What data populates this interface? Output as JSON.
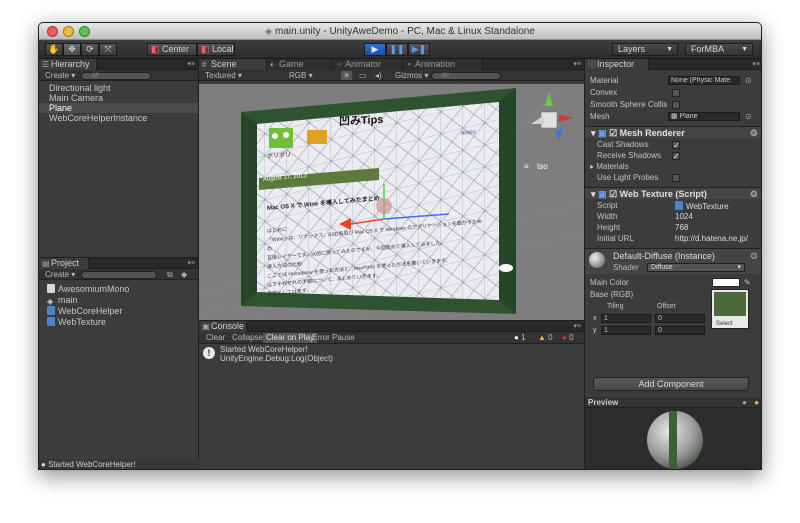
{
  "window": {
    "title": "main.unity - UnityAweDemo - PC, Mac & Linux Standalone"
  },
  "toolbar": {
    "hand_icon": "hand-icon",
    "move_icon": "move-arrows-icon",
    "rotate_icon": "rotate-icon",
    "scale_icon": "scale-icon",
    "pivot_label": "Center",
    "space_label": "Local",
    "layers_label": "Layers",
    "layout_label": "ForMBA"
  },
  "hierarchy": {
    "tab_label": "Hierarchy",
    "create_label": "Create",
    "search_placeholder": "All",
    "items": [
      {
        "label": "Directional light",
        "selected": false
      },
      {
        "label": "Main Camera",
        "selected": false
      },
      {
        "label": "Plane",
        "selected": true
      },
      {
        "label": "WebCoreHelperInstance",
        "selected": false
      }
    ]
  },
  "project": {
    "tab_label": "Project",
    "create_label": "Create",
    "items": [
      {
        "label": "AwesomiumMono",
        "icon": "file-icon"
      },
      {
        "label": "main",
        "icon": "unity-scene-icon"
      },
      {
        "label": "WebCoreHelper",
        "icon": "csharp-script-icon"
      },
      {
        "label": "WebTexture",
        "icon": "csharp-script-icon"
      }
    ]
  },
  "scene": {
    "tabs": [
      {
        "label": "Scene",
        "active": true
      },
      {
        "label": "Game",
        "active": false
      },
      {
        "label": "Animator",
        "active": false
      },
      {
        "label": "Animation",
        "active": false
      }
    ],
    "render_mode": "Textured",
    "color_mode": "RGB",
    "gizmos_label": "Gizmos",
    "search_placeholder": "All",
    "view_label": "Iso",
    "web": {
      "blog_title": "凹みTips",
      "logo_text": "ポリポリ",
      "small_link": "aiueo",
      "date": "August 17, 2013",
      "article_title": "Mac OS X で Wine を導入してみたまとめ",
      "lines": [
        "はじめに",
        "「Wine」は、リナックス、BSD系及び Mac OS X で Windows のアプリケーションを動かすための",
        "互換レイヤーです。以前に使ってみたのですが、今回改めて導入してみました。",
        "導入方法の比較",
        "ここでは Homebrew を使った方法と、MacPorts を使った方法を書いていきます。",
        "以下それぞれの手順について、まとめていきます。",
        "手順としてはまず、..."
      ]
    }
  },
  "console": {
    "tab_label": "Console",
    "buttons": [
      {
        "label": "Clear",
        "on": false
      },
      {
        "label": "Collapse",
        "on": false
      },
      {
        "label": "Clear on Play",
        "on": true
      },
      {
        "label": "Error Pause",
        "on": false
      }
    ],
    "counts": {
      "log": "1",
      "warn": "0",
      "error": "0"
    },
    "message_line1": "Started WebCoreHelper!",
    "message_line2": "UnityEngine.Debug:Log(Object)"
  },
  "inspector": {
    "tab_label": "Inspector",
    "collider": {
      "material_label": "Material",
      "material_value": "None (Physic Mate",
      "convex_label": "Convex",
      "smooth_label": "Smooth Sphere Collis",
      "mesh_label": "Mesh",
      "mesh_value": "Plane"
    },
    "mesh_renderer": {
      "title": "Mesh Renderer",
      "cast_shadows": "Cast Shadows",
      "receive_shadows": "Receive Shadows",
      "materials": "Materials",
      "use_light_probes": "Use Light Probes"
    },
    "web_texture": {
      "title": "Web Texture (Script)",
      "script_label": "Script",
      "script_value": "WebTexture",
      "width_label": "Width",
      "width_value": "1024",
      "height_label": "Height",
      "height_value": "768",
      "url_label": "Initial URL",
      "url_value": "http://d.hatena.ne.jp/"
    },
    "material": {
      "title": "Default-Diffuse (Instance)",
      "shader_label": "Shader",
      "shader_value": "Diffuse",
      "main_color": "Main Color",
      "base_label": "Base (RGB)",
      "tiling_label": "Tiling",
      "offset_label": "Offset",
      "x_label": "x",
      "y_label": "y",
      "tile_x": "1",
      "tile_y": "1",
      "off_x": "0",
      "off_y": "0",
      "select_label": "Select"
    },
    "add_component": "Add Component"
  },
  "preview": {
    "label": "Preview"
  },
  "status": {
    "message": "Started WebCoreHelper!"
  },
  "colors": {
    "accent": "#2c6fd8",
    "selection": "#4c4c4c",
    "panel_bg": "#3c3c3c",
    "warn": "#e8c030",
    "error": "#d03030"
  }
}
